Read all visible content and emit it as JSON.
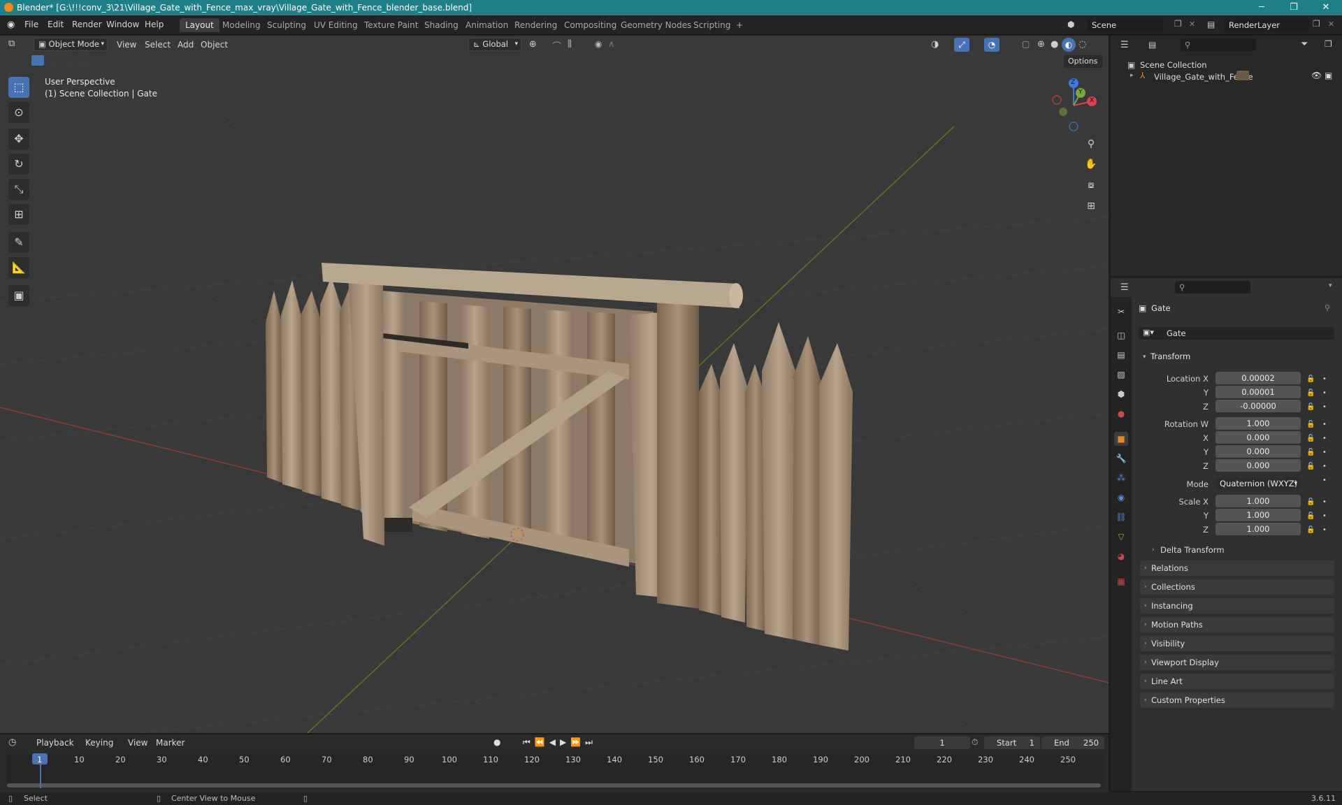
{
  "window": {
    "title": "Blender* [G:\\!!!conv_3\\21\\Village_Gate_with_Fence_max_vray\\Village_Gate_with_Fence_blender_base.blend]",
    "minimize": "─",
    "maximize": "❐",
    "close": "✕"
  },
  "menubar": [
    "File",
    "Edit",
    "Render",
    "Window",
    "Help"
  ],
  "workspaces": [
    "Layout",
    "Modeling",
    "Sculpting",
    "UV Editing",
    "Texture Paint",
    "Shading",
    "Animation",
    "Rendering",
    "Compositing",
    "Geometry Nodes",
    "Scripting",
    "+"
  ],
  "scene": {
    "name": "Scene",
    "view_layer": "RenderLayer"
  },
  "viewport": {
    "mode": "Object Mode",
    "menus": [
      "View",
      "Select",
      "Add",
      "Object"
    ],
    "orientation": "Global",
    "options": "Options",
    "overlay_line1": "User Perspective",
    "overlay_line2": "(1) Scene Collection | Gate",
    "gizmo": {
      "z": "Z",
      "y": "Y",
      "x": "X"
    }
  },
  "outliner": {
    "root": "Scene Collection",
    "item": "Village_Gate_with_Fence"
  },
  "properties": {
    "object_name": "Gate",
    "datablock_name": "Gate",
    "transform_header": "Transform",
    "location": {
      "label_x": "Location X",
      "label_y": "Y",
      "label_z": "Z",
      "x": "0.00002",
      "y": "0.00001",
      "z": "-0.00000"
    },
    "rotation": {
      "label_w": "Rotation W",
      "label_x": "X",
      "label_y": "Y",
      "label_z": "Z",
      "w": "1.000",
      "x": "0.000",
      "y": "0.000",
      "z": "0.000"
    },
    "mode_label": "Mode",
    "mode": "Quaternion (WXYZ)",
    "scale": {
      "label_x": "Scale X",
      "label_y": "Y",
      "label_z": "Z",
      "x": "1.000",
      "y": "1.000",
      "z": "1.000"
    },
    "delta": "Delta Transform",
    "panels": [
      "Relations",
      "Collections",
      "Instancing",
      "Motion Paths",
      "Visibility",
      "Viewport Display",
      "Line Art",
      "Custom Properties"
    ]
  },
  "timeline": {
    "menus": [
      "Playback",
      "Keying",
      "View",
      "Marker"
    ],
    "current_frame": "1",
    "start_label": "Start",
    "start": "1",
    "end_label": "End",
    "end": "250",
    "ticks": [
      "1",
      "10",
      "20",
      "30",
      "40",
      "50",
      "60",
      "70",
      "80",
      "90",
      "100",
      "110",
      "120",
      "130",
      "140",
      "150",
      "160",
      "170",
      "180",
      "190",
      "200",
      "210",
      "220",
      "230",
      "240",
      "250"
    ]
  },
  "status": {
    "select": "Select",
    "center": "Center View to Mouse",
    "version": "3.6.11"
  }
}
